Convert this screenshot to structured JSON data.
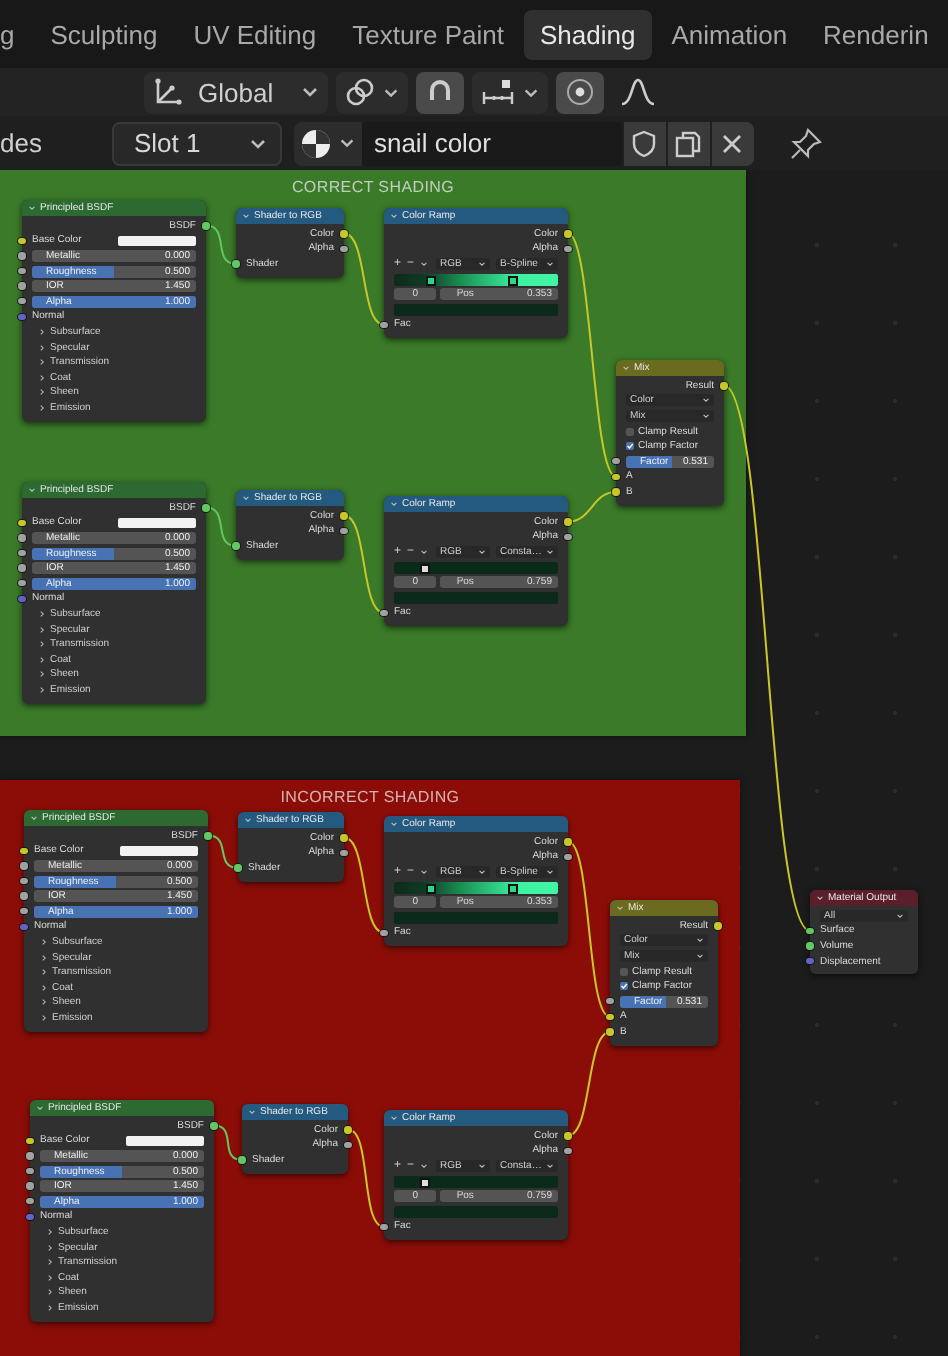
{
  "workspace_tabs": [
    {
      "label": "g",
      "selected": false
    },
    {
      "label": "Sculpting",
      "selected": false
    },
    {
      "label": "UV Editing",
      "selected": false
    },
    {
      "label": "Texture Paint",
      "selected": false
    },
    {
      "label": "Shading",
      "selected": true
    },
    {
      "label": "Animation",
      "selected": false
    },
    {
      "label": "Renderin",
      "selected": false
    }
  ],
  "toolbar": {
    "orientation": "Global",
    "snap_on": true,
    "proportional_on": true
  },
  "header": {
    "editor_label": "des",
    "slot": "Slot 1",
    "material": "snail color"
  },
  "frames": [
    {
      "label": "CORRECT SHADING",
      "color": "#3a7a29",
      "nodes": [
        {
          "kind": "shader",
          "title": "Principled BSDF",
          "items": [
            {
              "kind": "output",
              "label": "BSDF",
              "color": "#63c763"
            },
            {
              "kind": "color_input",
              "label": "Base Color",
              "color": "#c7c729"
            },
            {
              "kind": "slider",
              "label": "Metallic",
              "value": "0.000",
              "level": 0,
              "color": "#a1a1a1"
            },
            {
              "kind": "slider",
              "label": "Roughness",
              "value": "0.500",
              "level": 0.5,
              "color": "#a1a1a1"
            },
            {
              "kind": "number",
              "label": "IOR",
              "value": "1.450",
              "color": "#a1a1a1"
            },
            {
              "kind": "slider",
              "label": "Alpha",
              "value": "1.000",
              "level": 1,
              "color": "#a1a1a1"
            },
            {
              "kind": "input",
              "label": "Normal",
              "color": "#6363c7"
            },
            {
              "kind": "panel",
              "label": "Subsurface",
              "expanded": false
            },
            {
              "kind": "panel",
              "label": "Specular",
              "expanded": false
            },
            {
              "kind": "panel",
              "label": "Transmission",
              "expanded": false
            },
            {
              "kind": "panel",
              "label": "Coat",
              "expanded": false
            },
            {
              "kind": "panel",
              "label": "Sheen",
              "expanded": false
            },
            {
              "kind": "panel",
              "label": "Emission",
              "expanded": false
            }
          ]
        },
        {
          "kind": "converter",
          "title": "Shader to RGB",
          "items": [
            {
              "kind": "output",
              "label": "Color",
              "color": "#c7c729"
            },
            {
              "kind": "output",
              "label": "Alpha",
              "color": "#a1a1a1"
            },
            {
              "kind": "input",
              "label": "Shader",
              "color": "#63c763"
            }
          ]
        },
        {
          "kind": "converter",
          "title": "Color Ramp",
          "items": [
            {
              "kind": "output",
              "label": "Color",
              "color": "#c7c729"
            },
            {
              "kind": "output",
              "label": "Alpha",
              "color": "#a1a1a1"
            },
            {
              "kind": "ramp_tools",
              "plus": "+",
              "minus": "−",
              "mode": "RGB",
              "interpolation": "B-Spline"
            },
            {
              "kind": "ramp_gradient"
            },
            {
              "kind": "ramp_stop",
              "index": "0",
              "label": "Pos",
              "value": "0.353"
            },
            {
              "kind": "ramp_swatch"
            },
            {
              "kind": "input",
              "label": "Fac",
              "color": "#a1a1a1"
            }
          ]
        },
        {
          "kind": "shader",
          "title": "Principled BSDF",
          "items": [
            {
              "kind": "output",
              "label": "BSDF",
              "color": "#63c763"
            },
            {
              "kind": "color_input",
              "label": "Base Color",
              "color": "#c7c729"
            },
            {
              "kind": "slider",
              "label": "Metallic",
              "value": "0.000",
              "level": 0,
              "color": "#a1a1a1"
            },
            {
              "kind": "slider",
              "label": "Roughness",
              "value": "0.500",
              "level": 0.5,
              "color": "#a1a1a1"
            },
            {
              "kind": "number",
              "label": "IOR",
              "value": "1.450",
              "color": "#a1a1a1"
            },
            {
              "kind": "slider",
              "label": "Alpha",
              "value": "1.000",
              "level": 1,
              "color": "#a1a1a1"
            },
            {
              "kind": "input",
              "label": "Normal",
              "color": "#6363c7"
            },
            {
              "kind": "panel",
              "label": "Subsurface",
              "expanded": false
            },
            {
              "kind": "panel",
              "label": "Specular",
              "expanded": false
            },
            {
              "kind": "panel",
              "label": "Transmission",
              "expanded": false
            },
            {
              "kind": "panel",
              "label": "Coat",
              "expanded": false
            },
            {
              "kind": "panel",
              "label": "Sheen",
              "expanded": false
            },
            {
              "kind": "panel",
              "label": "Emission",
              "expanded": false
            }
          ]
        },
        {
          "kind": "converter",
          "title": "Shader to RGB",
          "items": [
            {
              "kind": "output",
              "label": "Color",
              "color": "#c7c729"
            },
            {
              "kind": "output",
              "label": "Alpha",
              "color": "#a1a1a1"
            },
            {
              "kind": "input",
              "label": "Shader",
              "color": "#63c763"
            }
          ]
        },
        {
          "kind": "converter",
          "title": "Color Ramp",
          "items": [
            {
              "kind": "output",
              "label": "Color",
              "color": "#c7c729"
            },
            {
              "kind": "output",
              "label": "Alpha",
              "color": "#a1a1a1"
            },
            {
              "kind": "ramp_tools",
              "plus": "+",
              "minus": "−",
              "mode": "RGB",
              "interpolation": "Consta…"
            },
            {
              "kind": "ramp_flat"
            },
            {
              "kind": "ramp_stop",
              "index": "0",
              "label": "Pos",
              "value": "0.759"
            },
            {
              "kind": "ramp_swatch"
            },
            {
              "kind": "input",
              "label": "Fac",
              "color": "#a1a1a1"
            }
          ]
        },
        {
          "kind": "color",
          "title": "Mix",
          "items": [
            {
              "kind": "output",
              "label": "Result",
              "color": "#c7c729"
            },
            {
              "kind": "dropdown",
              "value": "Color"
            },
            {
              "kind": "dropdown",
              "value": "Mix"
            },
            {
              "kind": "checkbox",
              "label": "Clamp Result",
              "checked": false
            },
            {
              "kind": "checkbox",
              "label": "Clamp Factor",
              "checked": true
            },
            {
              "kind": "slider",
              "label": "Factor",
              "value": "0.531",
              "level": 0.531,
              "color": "#a1a1a1"
            },
            {
              "kind": "input",
              "label": "A",
              "color": "#c7c729"
            },
            {
              "kind": "input",
              "label": "B",
              "color": "#c7c729"
            }
          ]
        }
      ]
    },
    {
      "label": "INCORRECT SHADING",
      "color": "#8c0d08",
      "nodes": [
        {
          "kind": "shader",
          "title": "Principled BSDF",
          "items": [
            {
              "kind": "output",
              "label": "BSDF",
              "color": "#63c763"
            },
            {
              "kind": "color_input",
              "label": "Base Color",
              "color": "#c7c729"
            },
            {
              "kind": "slider",
              "label": "Metallic",
              "value": "0.000",
              "level": 0,
              "color": "#a1a1a1"
            },
            {
              "kind": "slider",
              "label": "Roughness",
              "value": "0.500",
              "level": 0.5,
              "color": "#a1a1a1"
            },
            {
              "kind": "number",
              "label": "IOR",
              "value": "1.450",
              "color": "#a1a1a1"
            },
            {
              "kind": "slider",
              "label": "Alpha",
              "value": "1.000",
              "level": 1,
              "color": "#a1a1a1"
            },
            {
              "kind": "input",
              "label": "Normal",
              "color": "#6363c7"
            },
            {
              "kind": "panel",
              "label": "Subsurface",
              "expanded": false
            },
            {
              "kind": "panel",
              "label": "Specular",
              "expanded": false
            },
            {
              "kind": "panel",
              "label": "Transmission",
              "expanded": false
            },
            {
              "kind": "panel",
              "label": "Coat",
              "expanded": false
            },
            {
              "kind": "panel",
              "label": "Sheen",
              "expanded": false
            },
            {
              "kind": "panel",
              "label": "Emission",
              "expanded": false
            }
          ]
        },
        {
          "kind": "converter",
          "title": "Shader to RGB",
          "items": [
            {
              "kind": "output",
              "label": "Color",
              "color": "#c7c729"
            },
            {
              "kind": "output",
              "label": "Alpha",
              "color": "#a1a1a1"
            },
            {
              "kind": "input",
              "label": "Shader",
              "color": "#63c763"
            }
          ]
        },
        {
          "kind": "converter",
          "title": "Color Ramp",
          "items": [
            {
              "kind": "output",
              "label": "Color",
              "color": "#c7c729"
            },
            {
              "kind": "output",
              "label": "Alpha",
              "color": "#a1a1a1"
            },
            {
              "kind": "ramp_tools",
              "plus": "+",
              "minus": "−",
              "mode": "RGB",
              "interpolation": "B-Spline"
            },
            {
              "kind": "ramp_gradient"
            },
            {
              "kind": "ramp_stop",
              "index": "0",
              "label": "Pos",
              "value": "0.353"
            },
            {
              "kind": "ramp_swatch"
            },
            {
              "kind": "input",
              "label": "Fac",
              "color": "#a1a1a1"
            }
          ]
        },
        {
          "kind": "shader",
          "title": "Principled BSDF",
          "items": [
            {
              "kind": "output",
              "label": "BSDF",
              "color": "#63c763"
            },
            {
              "kind": "color_input",
              "label": "Base Color",
              "color": "#c7c729"
            },
            {
              "kind": "slider",
              "label": "Metallic",
              "value": "0.000",
              "level": 0,
              "color": "#a1a1a1"
            },
            {
              "kind": "slider",
              "label": "Roughness",
              "value": "0.500",
              "level": 0.5,
              "color": "#a1a1a1"
            },
            {
              "kind": "number",
              "label": "IOR",
              "value": "1.450",
              "color": "#a1a1a1"
            },
            {
              "kind": "slider",
              "label": "Alpha",
              "value": "1.000",
              "level": 1,
              "color": "#a1a1a1"
            },
            {
              "kind": "input",
              "label": "Normal",
              "color": "#6363c7"
            },
            {
              "kind": "panel",
              "label": "Subsurface",
              "expanded": false
            },
            {
              "kind": "panel",
              "label": "Specular",
              "expanded": false
            },
            {
              "kind": "panel",
              "label": "Transmission",
              "expanded": false
            },
            {
              "kind": "panel",
              "label": "Coat",
              "expanded": false
            },
            {
              "kind": "panel",
              "label": "Sheen",
              "expanded": false
            },
            {
              "kind": "panel",
              "label": "Emission",
              "expanded": false
            }
          ]
        },
        {
          "kind": "converter",
          "title": "Shader to RGB",
          "items": [
            {
              "kind": "output",
              "label": "Color",
              "color": "#c7c729"
            },
            {
              "kind": "output",
              "label": "Alpha",
              "color": "#a1a1a1"
            },
            {
              "kind": "input",
              "label": "Shader",
              "color": "#63c763"
            }
          ]
        },
        {
          "kind": "converter",
          "title": "Color Ramp",
          "items": [
            {
              "kind": "output",
              "label": "Color",
              "color": "#c7c729"
            },
            {
              "kind": "output",
              "label": "Alpha",
              "color": "#a1a1a1"
            },
            {
              "kind": "ramp_tools",
              "plus": "+",
              "minus": "−",
              "mode": "RGB",
              "interpolation": "Consta…"
            },
            {
              "kind": "ramp_flat"
            },
            {
              "kind": "ramp_stop",
              "index": "0",
              "label": "Pos",
              "value": "0.759"
            },
            {
              "kind": "ramp_swatch"
            },
            {
              "kind": "input",
              "label": "Fac",
              "color": "#a1a1a1"
            }
          ]
        },
        {
          "kind": "color",
          "title": "Mix",
          "items": [
            {
              "kind": "output",
              "label": "Result",
              "color": "#c7c729"
            },
            {
              "kind": "dropdown",
              "value": "Color"
            },
            {
              "kind": "dropdown",
              "value": "Mix"
            },
            {
              "kind": "checkbox",
              "label": "Clamp Result",
              "checked": false
            },
            {
              "kind": "checkbox",
              "label": "Clamp Factor",
              "checked": true
            },
            {
              "kind": "slider",
              "label": "Factor",
              "value": "0.531",
              "level": 0.531,
              "color": "#a1a1a1"
            },
            {
              "kind": "input",
              "label": "A",
              "color": "#c7c729"
            },
            {
              "kind": "input",
              "label": "B",
              "color": "#c7c729"
            }
          ]
        }
      ]
    }
  ],
  "free_nodes": [
    {
      "kind": "output",
      "title": "Material Output",
      "items": [
        {
          "kind": "dropdown",
          "value": "All"
        },
        {
          "kind": "input",
          "label": "Surface",
          "color": "#63c763"
        },
        {
          "kind": "input",
          "label": "Volume",
          "color": "#63c763"
        },
        {
          "kind": "input",
          "label": "Displacement",
          "color": "#6363c7"
        }
      ]
    }
  ]
}
